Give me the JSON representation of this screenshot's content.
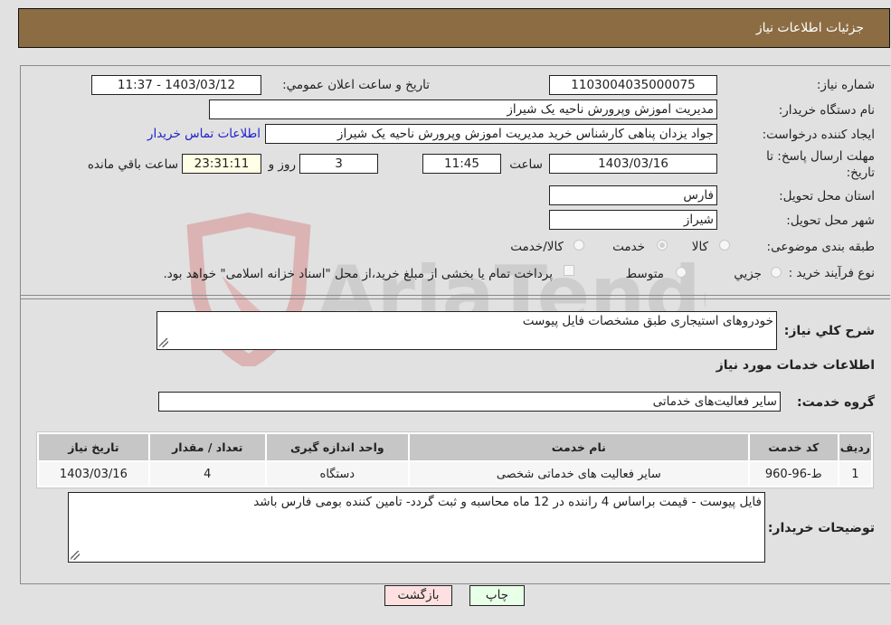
{
  "header": {
    "title": "جزئیات اطلاعات نیاز"
  },
  "form": {
    "need_number": {
      "label": "شماره نیاز:",
      "value": "1103004035000075"
    },
    "announce_datetime": {
      "label": "تاریخ و ساعت اعلان عمومي:",
      "value": "1403/03/12 - 11:37"
    },
    "buyer_org": {
      "label": "نام دستگاه خریدار:",
      "value": "مدیریت اموزش وپرورش ناحیه یک شیراز"
    },
    "requester": {
      "label": "ایجاد کننده درخواست:",
      "value": "جواد یزدان پناهی کارشناس خرید مدیریت اموزش وپرورش ناحیه یک شیراز"
    },
    "buyer_contact_link": "اطلاعات تماس خریدار",
    "deadline": {
      "label_line1": "مهلت ارسال پاسخ: تا",
      "label_line2": "تاریخ:",
      "date": "1403/03/16",
      "time_label": "ساعت",
      "time": "11:45",
      "days": "3",
      "days_label": "روز و",
      "remaining": "23:31:11",
      "remaining_label": "ساعت باقي مانده"
    },
    "province": {
      "label": "استان محل تحویل:",
      "value": "فارس"
    },
    "city": {
      "label": "شهر محل تحویل:",
      "value": "شیراز"
    },
    "category": {
      "label": "طبقه بندی موضوعی:",
      "options": [
        "کالا",
        "خدمت",
        "کالا/خدمت"
      ],
      "selected": "خدمت"
    },
    "process_type": {
      "label": "نوع فرآیند خرید :",
      "options": [
        "جزيي",
        "متوسط"
      ],
      "payment_note": "پرداخت تمام یا بخشی از مبلغ خرید،از محل \"اسناد خزانه اسلامی\" خواهد بود."
    }
  },
  "description": {
    "label": "شرح کلي نیاز:",
    "value": "خودروهای استیجاری طبق مشخصات فایل پیوست"
  },
  "services_section": {
    "title": "اطلاعات خدمات مورد نیاز"
  },
  "service_group": {
    "label": "گروه خدمت:",
    "value": "سایر فعالیت‌های خدماتی"
  },
  "table": {
    "headers": [
      "ردیف",
      "کد خدمت",
      "نام خدمت",
      "واحد اندازه گیری",
      "تعداد / مقدار",
      "تاریخ نیاز"
    ],
    "rows": [
      [
        "1",
        "ط-96-960",
        "سایر فعالیت های خدماتی شخصی",
        "دستگاه",
        "4",
        "1403/03/16"
      ]
    ]
  },
  "buyer_notes": {
    "label": "توضیحات خریدار:",
    "value": "فایل پیوست - قیمت براساس 4 راننده در 12 ماه محاسبه و ثبت گردد- تامین کننده بومی فارس باشد"
  },
  "buttons": {
    "print": "چاپ",
    "back": "بازگشت"
  },
  "watermark": {
    "text": "AriaTender.neT"
  }
}
